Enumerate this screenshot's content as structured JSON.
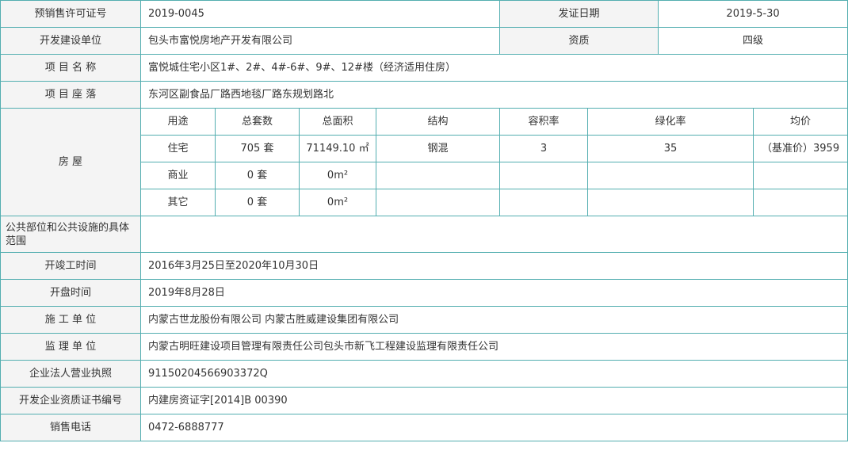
{
  "license": {
    "label": "预销售许可证号",
    "value": "2019-0045",
    "issue_label": "发证日期",
    "issue_value": "2019-5-30"
  },
  "developer": {
    "label": "开发建设单位",
    "value": "包头市富悦房地产开发有限公司",
    "qual_label": "资质",
    "qual_value": "四级"
  },
  "project_name": {
    "label": "项 目 名 称",
    "value": "富悦城住宅小区1#、2#、4#-6#、9#、12#楼（经济适用住房）"
  },
  "project_location": {
    "label": "项 目 座 落",
    "value": "东河区副食品厂路西地毯厂路东规划路北"
  },
  "housing": {
    "label": "房 屋",
    "headers": [
      "用途",
      "总套数",
      "总面积",
      "结构",
      "容积率",
      "绿化率",
      "均价"
    ],
    "rows": [
      [
        "住宅",
        "705 套",
        "71149.10 ㎡",
        "钢混",
        "3",
        "35",
        "（基准价）3959"
      ],
      [
        "商业",
        "0 套",
        "0m²",
        "",
        "",
        "",
        ""
      ],
      [
        "其它",
        "0 套",
        "0m²",
        "",
        "",
        "",
        ""
      ]
    ]
  },
  "public_facilities": {
    "label": "公共部位和公共设施的具体范围",
    "value": ""
  },
  "construction_period": {
    "label": "开竣工时间",
    "value": "2016年3月25日至2020年10月30日"
  },
  "opening_date": {
    "label": "开盘时间",
    "value": "2019年8月28日"
  },
  "contractor": {
    "label": "施 工 单 位",
    "value": "内蒙古世龙股份有限公司 内蒙古胜威建设集团有限公司"
  },
  "supervisor": {
    "label": "监 理 单 位",
    "value": "内蒙古明旺建设项目管理有限责任公司包头市新飞工程建设监理有限责任公司"
  },
  "business_license": {
    "label": "企业法人营业执照",
    "value": "91150204566903372Q"
  },
  "qualification_cert": {
    "label": "开发企业资质证书编号",
    "value": "内建房资证字[2014]B 00390"
  },
  "sales_phone": {
    "label": "销售电话",
    "value": "0472-6888777"
  }
}
